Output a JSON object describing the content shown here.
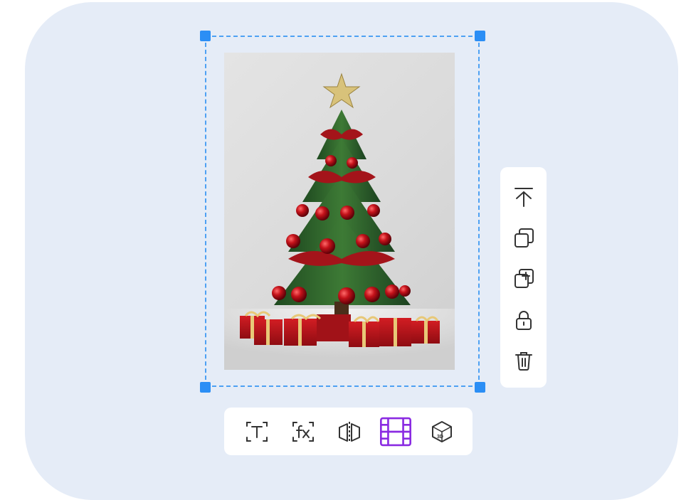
{
  "canvas": {
    "accent_color": "#2b8ef5",
    "selection_color": "#4ea1f3",
    "active_tool_color": "#8a2be2"
  },
  "image": {
    "subject": "christmas-tree"
  },
  "side_toolbar": {
    "items": [
      {
        "icon": "bring-to-front-icon"
      },
      {
        "icon": "copy-icon"
      },
      {
        "icon": "duplicate-add-icon"
      },
      {
        "icon": "lock-icon"
      },
      {
        "icon": "trash-icon"
      }
    ]
  },
  "bottom_toolbar": {
    "items": [
      {
        "icon": "text-recognize-icon",
        "active": false
      },
      {
        "icon": "fx-effects-icon",
        "active": false
      },
      {
        "icon": "flip-mirror-icon",
        "active": false
      },
      {
        "icon": "film-video-icon",
        "active": true
      },
      {
        "icon": "3d-icon",
        "active": false
      }
    ]
  }
}
